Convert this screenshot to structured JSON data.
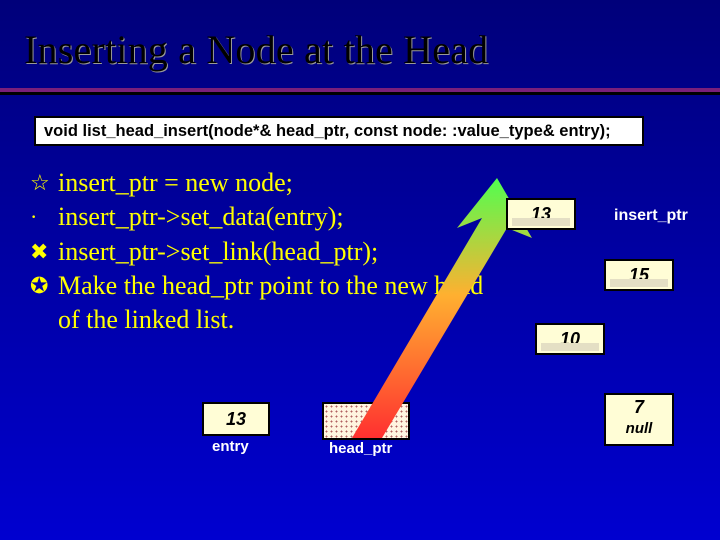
{
  "title": "Inserting a Node at the Head",
  "signature": "void list_head_insert(node*& head_ptr, const node: :value_type& entry);",
  "bullets": {
    "b1_icon": "☆",
    "b1_text": "insert_ptr = new node;",
    "b2_icon": "·",
    "b2_text": "insert_ptr->set_data(entry);",
    "b3_icon": "✖",
    "b3_text": "insert_ptr->set_link(head_ptr);",
    "b4_icon": "✪",
    "b4_text": "Make the head_ptr point to the new head of the linked list."
  },
  "entry": {
    "value": "13",
    "label": "entry"
  },
  "head_ptr": {
    "label": "head_ptr"
  },
  "insert_ptr_label": "insert_ptr",
  "nodes": {
    "n13": "13",
    "n15": "15",
    "n10": "10",
    "n7": "7",
    "null": "null"
  }
}
